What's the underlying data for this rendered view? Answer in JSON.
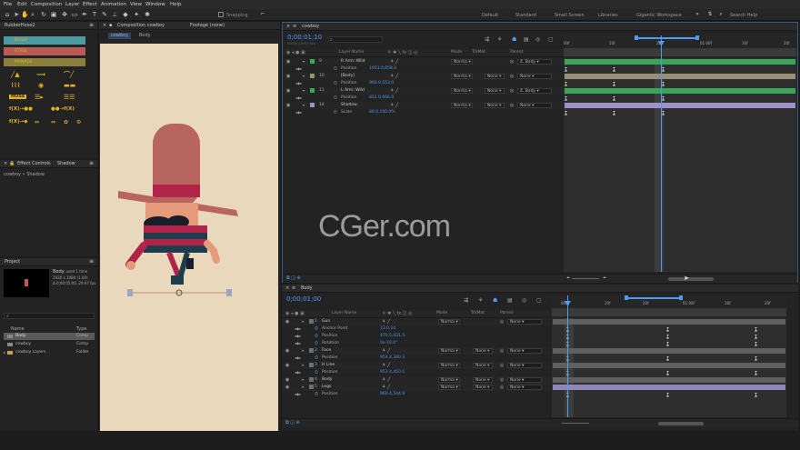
{
  "menu": [
    "File",
    "Edit",
    "Composition",
    "Layer",
    "Effect",
    "Animation",
    "View",
    "Window",
    "Help"
  ],
  "toolbar": {
    "snapping_label": "Snapping"
  },
  "workspaces": [
    "Default",
    "Standard",
    "Small Screen",
    "Libraries",
    "Gigantic Workspace"
  ],
  "search_help": "Search Help",
  "rubberhose": {
    "title": "RubberHose2",
    "build": "BUILD",
    "style": "STYLE",
    "manage": "MANAGE",
    "icons": [
      "f(X)",
      "f(X)",
      "f(X)",
      "f(X)"
    ]
  },
  "effect_controls": {
    "title": "Effect Controls",
    "layer": "Shadow",
    "breadcrumb": "cowboy • Shadow"
  },
  "project": {
    "title": "Project",
    "selected_name": "Body",
    "selected_used": ", used 1 time",
    "selected_size": "1920 x 1080 (1.00)",
    "selected_dur": "Δ 0;00;05;00, 29.97 fps",
    "columns": [
      "Name",
      "Type"
    ],
    "items": [
      {
        "name": "Body",
        "type": "Comp"
      },
      {
        "name": "cowboy",
        "type": "Comp"
      },
      {
        "name": "cowboy Layers",
        "type": "Folder"
      }
    ]
  },
  "viewer": {
    "tabs": [
      "Composition cowboy",
      "Footage (none)"
    ],
    "sub": [
      "cowboy",
      "Body"
    ]
  },
  "timeline_top": {
    "tab": "cowboy",
    "timecode": "0;00;01;10",
    "fps": "00040 (29.97 fps)",
    "columns": [
      "Layer Name",
      "Mode",
      "TrkMat",
      "Parent"
    ],
    "ruler": [
      "00f",
      "10f",
      "20f",
      "01:00f",
      "10f",
      "20f"
    ],
    "rows": [
      {
        "num": "9",
        "name": "R Arm::Wild",
        "mode": "Norma",
        "parent": "4. Body",
        "label": "#3aa65a",
        "kind": "layer"
      },
      {
        "name": "Position",
        "value": "1053.0,858.0",
        "kind": "prop"
      },
      {
        "num": "10",
        "name": "[Body]",
        "mode": "Norma",
        "trk": "None",
        "parent": "None",
        "label": "#9a8e76",
        "kind": "layer"
      },
      {
        "name": "Position",
        "value": "960.0,553.0",
        "kind": "prop"
      },
      {
        "num": "11",
        "name": "L Arm::Wild",
        "mode": "Norma",
        "trk": "None",
        "parent": "4. Body",
        "label": "#3aa65a",
        "kind": "layer"
      },
      {
        "name": "Position",
        "value": "852.0,666.0",
        "kind": "prop"
      },
      {
        "num": "14",
        "name": "Shadow",
        "mode": "Norma",
        "trk": "None",
        "parent": "None",
        "label": "#9f90c9",
        "kind": "layer"
      },
      {
        "name": "Scale",
        "value": "80.0,100.0%",
        "kind": "prop"
      }
    ]
  },
  "timeline_bottom": {
    "tab": "Body",
    "timecode": "0;00;01;00",
    "columns": [
      "Layer Name",
      "Mode",
      "TrkMat",
      "Parent"
    ],
    "ruler": [
      "00f",
      "10f",
      "20f",
      "01:00f",
      "10f",
      "20f"
    ],
    "rows": [
      {
        "num": "1",
        "name": "Gun",
        "mode": "Norma",
        "parent": "None",
        "kind": "layer"
      },
      {
        "name": "Anchor Point",
        "value": "13.0,14",
        "kind": "prop"
      },
      {
        "name": "Position",
        "value": "970.5,431.5",
        "kind": "prop"
      },
      {
        "name": "Rotation",
        "value": "0x-10.0°",
        "kind": "prop"
      },
      {
        "num": "2",
        "name": "Face",
        "mode": "Norma",
        "trk": "None",
        "parent": "None",
        "kind": "layer"
      },
      {
        "name": "Position",
        "value": "954.4,340.3",
        "kind": "prop"
      },
      {
        "num": "3",
        "name": "H Line",
        "mode": "Norma",
        "trk": "None",
        "parent": "None",
        "kind": "layer"
      },
      {
        "name": "Position",
        "value": "953.4,450.1",
        "kind": "prop"
      },
      {
        "num": "4",
        "name": "Body",
        "mode": "Norma",
        "trk": "None",
        "parent": "None",
        "kind": "layer"
      },
      {
        "num": "5",
        "name": "Legs",
        "mode": "Norma",
        "trk": "None",
        "parent": "None",
        "kind": "layer"
      },
      {
        "name": "Position",
        "value": "960.4,544.9",
        "kind": "prop"
      }
    ]
  },
  "watermark": "CGer.com",
  "colors": {
    "accent": "#4f9bef",
    "build": "#4d9ba0",
    "style": "#b95b54",
    "manage": "#8a7f3c",
    "panel": "#232323"
  }
}
